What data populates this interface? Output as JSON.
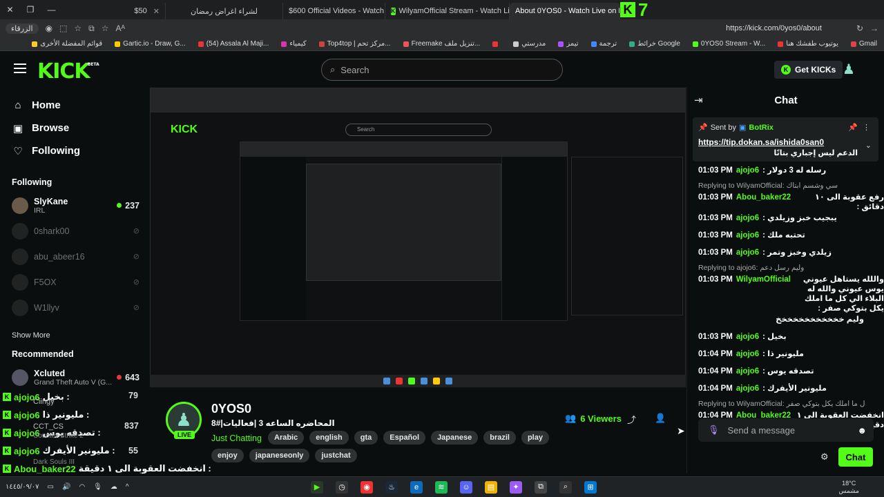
{
  "browser": {
    "tabs": [
      {
        "label": "$50",
        "active": false
      },
      {
        "label": "لشراء اغراض رمضان",
        "active": false
      },
      {
        "label": "$600 Official Videos - Watch On",
        "active": false
      },
      {
        "label": "WilyamOfficial Stream - Watch Live",
        "active": false
      },
      {
        "label": "About 0YOS0 - Watch Live on Kick",
        "active": true
      }
    ],
    "tab_counter": "7",
    "url": "https://kick.com/0yos0/about",
    "profile_label": "الزرقاء",
    "bookmarks": [
      "Gmail",
      "يوتيوب طفشك هنا",
      "0YOS0 Stream - W...",
      "خرائط Google",
      "ترجمة",
      "تيمز",
      "مدرستي",
      "",
      "Freemake تنزيل ملف...",
      "Top4top | مركز تحم...",
      "كيمياء",
      "(54) Assala Al Maji...",
      "Gartic.io - Draw, G...",
      "قوائم المفضلة الأخرى"
    ]
  },
  "header": {
    "logo": "KICK",
    "logo_beta": "BETA",
    "search_placeholder": "Search",
    "get_kicks": "Get KICKs"
  },
  "sidebar": {
    "nav": [
      {
        "label": "Home",
        "icon": "home-icon"
      },
      {
        "label": "Browse",
        "icon": "browse-icon"
      },
      {
        "label": "Following",
        "icon": "heart-icon"
      }
    ],
    "following_heading": "Following",
    "following": [
      {
        "name": "SlyKane",
        "sub": "IRL",
        "viewers": "237",
        "live": true
      },
      {
        "name": "0shark00",
        "live": false
      },
      {
        "name": "abu_abeer16",
        "live": false
      },
      {
        "name": "F5OX",
        "live": false
      },
      {
        "name": "W1llyv",
        "live": false
      }
    ],
    "show_more": "Show More",
    "recommended_heading": "Recommended",
    "recommended": [
      {
        "name": "Xcluted",
        "sub": "Grand Theft Auto V (G...",
        "viewers": "643"
      }
    ]
  },
  "overlay_chat": [
    {
      "user": "ajojo6",
      "text": "بخيل :",
      "extra": "79"
    },
    {
      "user": "ajojo6",
      "text": "مليونير ذا :",
      "extra": "837"
    },
    {
      "user": "ajojo6",
      "text": "تصدقه يوس :",
      "extra": ""
    },
    {
      "user": "ajojo6",
      "text": "مليونير الأيفرك :",
      "extra": "55"
    },
    {
      "user": "Abou_baker22",
      "text": "انخفضت العقوبة الى ١ دقيقة :",
      "extra": ""
    }
  ],
  "overlay_side_names": [
    "Ciingy",
    "CCT_CS",
    "Counter-Strike 2",
    "Dark Souls III"
  ],
  "stream": {
    "channel": "0YOS0",
    "title": "المحاضره الساعه 3 |فعاليات|#8",
    "live_badge": "LIVE",
    "category": "Just Chatting",
    "tags": [
      "Arabic",
      "english",
      "gta",
      "Español",
      "Japanese",
      "brazil",
      "play"
    ],
    "tags2": [
      "enjoy",
      "japaneseonly",
      "justchat"
    ],
    "viewers": "6 Viewers"
  },
  "chat": {
    "title": "Chat",
    "pinned": {
      "sent_by_label": "Sent by",
      "bot_name": "BotRix",
      "link": "https://tip.dokan.sa/ishida0san0",
      "text": "الدعم ليس إجباري بتاتًا"
    },
    "messages": [
      {
        "time": "01:03 PM",
        "user": "ajojo6",
        "text": "رسله له 3 دولار :"
      },
      {
        "reply": "Replying to WilyamOfficial: سي وشسم ابتاك",
        "time": "01:03 PM",
        "user": "Abou_baker22",
        "text": "رفع عقوبة الى ١٠ دقائق :"
      },
      {
        "time": "01:03 PM",
        "user": "ajojo6",
        "text": "يبجيب خبز وزيلدي :"
      },
      {
        "time": "01:03 PM",
        "user": "ajojo6",
        "text": "تحتبه ملك :"
      },
      {
        "time": "01:03 PM",
        "user": "ajojo6",
        "text": "زيلدي وخبز وتمر :"
      },
      {
        "reply": "Replying to ajojo6: وليم رسل دعم",
        "time": "01:03 PM",
        "user": "WilyamOfficial",
        "text": "واللله يستاهل عيوني يوس عيوني والله له البلاء الي كل ما املك يكل بتوكي صفر :"
      },
      {
        "time": "01:03 PM",
        "user": "",
        "text": "وليم خخخخخخخخخخخخ"
      },
      {
        "time": "01:03 PM",
        "user": "ajojo6",
        "text": "بخيل :"
      },
      {
        "time": "01:04 PM",
        "user": "ajojo6",
        "text": "مليونير ذا :"
      },
      {
        "time": "01:04 PM",
        "user": "ajojo6",
        "text": "تصدقه يوس :"
      },
      {
        "time": "01:04 PM",
        "user": "ajojo6",
        "text": "مليونير الأيفرك :"
      },
      {
        "reply": "Replying to WilyamOfficial: ل ما املك يكل بتوكي صفر",
        "time": "01:04 PM",
        "user": "Abou_baker22",
        "text": "انخفضت العقوبة الى ١ دقيقة :"
      }
    ],
    "input_placeholder": "Send a message",
    "send_label": "Chat"
  },
  "taskbar": {
    "time": "18°C",
    "weather": "مشمس",
    "date": "١٤٤٥/٠٩/٠٧"
  }
}
